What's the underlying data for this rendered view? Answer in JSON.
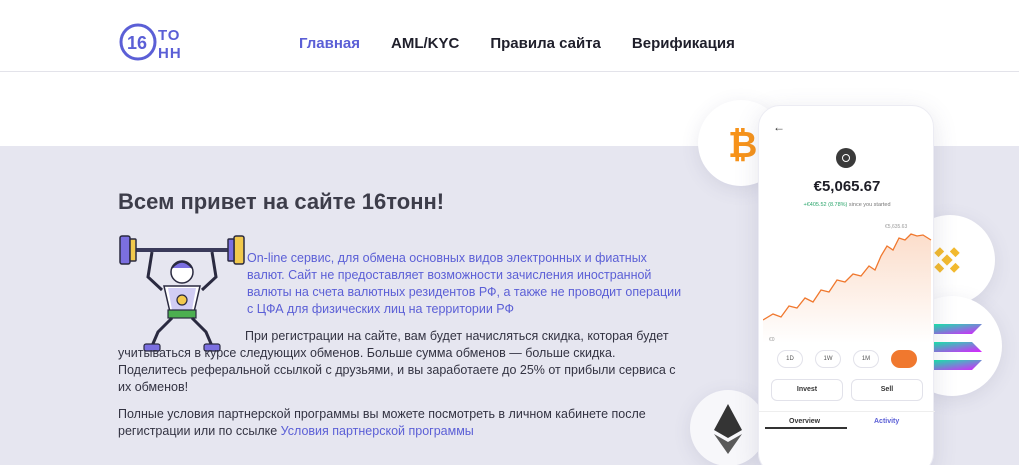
{
  "header": {
    "logo": {
      "number": "16",
      "text_top": "ТО",
      "text_bottom": "НН"
    },
    "nav": [
      "Главная",
      "AML/KYC",
      "Правила сайта",
      "Верификация"
    ]
  },
  "main": {
    "title": "Всем привет на сайте 16тонн!",
    "paragraph1": "On-line сервис, для обмена основных видов электронных и фиатных валют. Сайт не предоставляет возможности зачисления иностранной валюты на счета валютных резидентов РФ, а также не проводит операции с ЦФА для физических лиц на территории РФ",
    "paragraph2_line1": "При регистрации на сайте, вам будет начисляться скидка, которая будет",
    "paragraph2_rest": "учитываться в курсе следующих обменов. Больше сумма обменов — больше скидка. Поделитесь реферальной ссылкой с друзьями, и вы заработаете до 25% от прибыли сервиса с их обменов!",
    "paragraph3": "Полные условия партнерской программы вы можете посмотреть в личном кабинете после регистрации или по ссылке ",
    "paragraph3_link": "Условия партнерской программы"
  },
  "phone": {
    "back": "←",
    "value": "€5,065.67",
    "change_value": "+€405.52 (8.78%)",
    "change_text": " since you started",
    "high_label": "€5,635.63",
    "low_label": "€0",
    "tabs": [
      "1D",
      "1W",
      "1M",
      ""
    ],
    "invest": "Invest",
    "sell": "Sell",
    "overview": "Overview",
    "activity": "Activity"
  },
  "colors": {
    "accent": "#5b5fd6",
    "hero_bg": "#e6e6f0",
    "chart_line": "#f0782e",
    "btc": "#f7931a",
    "bnb": "#f3ba2f"
  },
  "icons": [
    "bitcoin-coin-icon",
    "binance-coin-icon",
    "solana-coin-icon",
    "ethereum-coin-icon",
    "phone-coin-icon"
  ]
}
